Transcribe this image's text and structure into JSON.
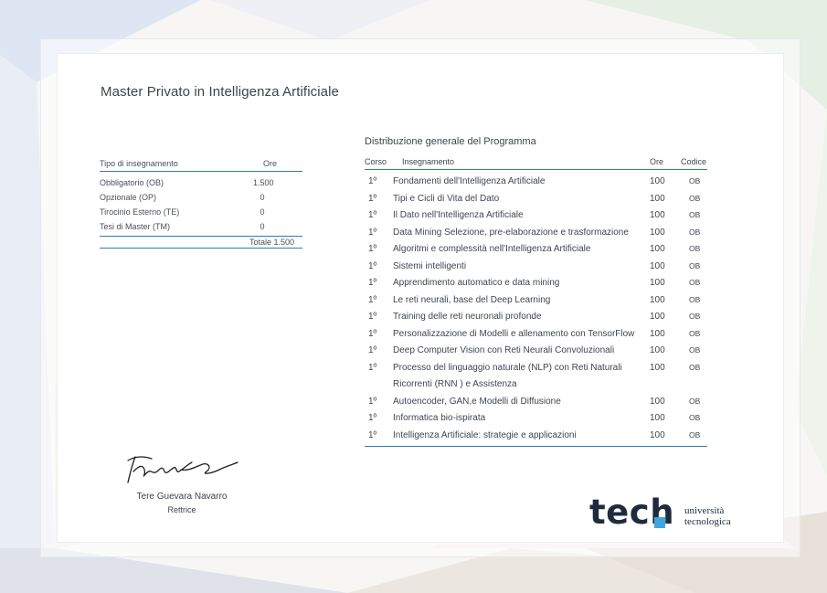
{
  "header": {
    "title": "Master Privato in Intelligenza Artificiale"
  },
  "summary_table": {
    "col_type": "Tipo di insegnamento",
    "col_hours": "Ore",
    "rows": [
      {
        "type": "Obbligatorio (OB)",
        "hours": "1.500"
      },
      {
        "type": "Opzionale (OP)",
        "hours": "0"
      },
      {
        "type": "Tirocinio Esterno (TE)",
        "hours": "0"
      },
      {
        "type": "Tesi di Master (TM)",
        "hours": "0"
      }
    ],
    "total": "Totale 1.500"
  },
  "program": {
    "title": "Distribuzione generale del Programma",
    "col_corso": "Corso",
    "col_name": "Insegnamento",
    "col_hours": "Ore",
    "col_code": "Codice",
    "rows": [
      {
        "corso": "1º",
        "name": "Fondamenti dell'Intelligenza Artificiale",
        "hours": "100",
        "code": "OB"
      },
      {
        "corso": "1º",
        "name": "Tipi e Cicli di Vita del Dato",
        "hours": "100",
        "code": "OB"
      },
      {
        "corso": "1º",
        "name": "Il Dato nell'Intelligenza Artificiale",
        "hours": "100",
        "code": "OB"
      },
      {
        "corso": "1º",
        "name": "Data Mining Selezione, pre-elaborazione e trasformazione",
        "hours": "100",
        "code": "OB"
      },
      {
        "corso": "1º",
        "name": "Algoritmi e complessità nell'Intelligenza Artificiale",
        "hours": "100",
        "code": "OB"
      },
      {
        "corso": "1º",
        "name": "Sistemi intelligenti",
        "hours": "100",
        "code": "OB"
      },
      {
        "corso": "1º",
        "name": "Apprendimento automatico e data mining",
        "hours": "100",
        "code": "OB"
      },
      {
        "corso": "1º",
        "name": "Le reti neurali, base del Deep Learning",
        "hours": "100",
        "code": "OB"
      },
      {
        "corso": "1º",
        "name": "Training delle reti neuronali profonde",
        "hours": "100",
        "code": "OB"
      },
      {
        "corso": "1º",
        "name": "Personalizzazione di Modelli e allenamento con TensorFlow",
        "hours": "100",
        "code": "OB"
      },
      {
        "corso": "1º",
        "name": "Deep Computer Vision con Reti Neurali Convoluzionali",
        "hours": "100",
        "code": "OB"
      },
      {
        "corso": "1º",
        "name": "Processo del linguaggio naturale (NLP) con Reti Naturali Ricorrenti (RNN ) e Assistenza",
        "hours": "100",
        "code": "OB"
      },
      {
        "corso": "1º",
        "name": "Autoencoder, GAN,e Modelli di Diffusione",
        "hours": "100",
        "code": "OB"
      },
      {
        "corso": "1º",
        "name": "Informatica bio-ispirata",
        "hours": "100",
        "code": "OB"
      },
      {
        "corso": "1º",
        "name": "Intelligenza Artificiale: strategie e applicazioni",
        "hours": "100",
        "code": "OB"
      }
    ]
  },
  "signature": {
    "name": "Tere Guevara Navarro",
    "role": "Rettrice"
  },
  "logo": {
    "wordmark": "tech",
    "line1": "università",
    "line2": "tecnologica",
    "accent_color": "#3fa6dc",
    "text_color": "#1f2b3d"
  },
  "colors": {
    "rule": "#2f7bbf"
  }
}
